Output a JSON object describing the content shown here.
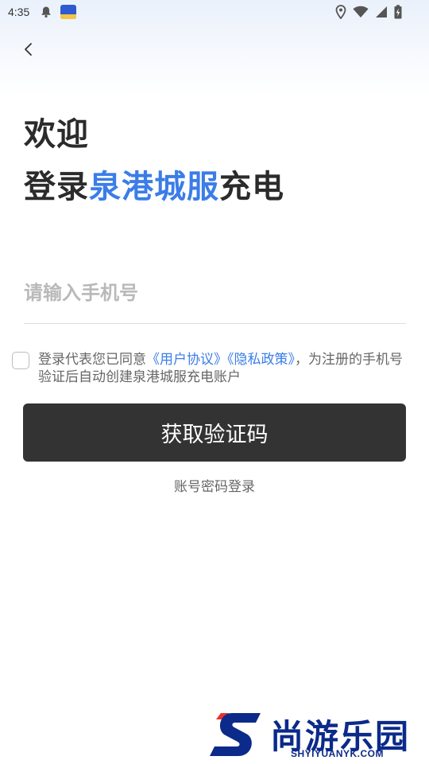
{
  "status_bar": {
    "time": "4:35",
    "icons": [
      "bell-icon",
      "app-notification-icon",
      "location-icon",
      "wifi-icon",
      "signal-icon",
      "battery-charging-icon"
    ]
  },
  "header": {
    "back_icon": "chevron-left-icon"
  },
  "title": {
    "line1": "欢迎",
    "line2_prefix": "登录",
    "line2_brand": "泉港城服",
    "line2_suffix": "充电"
  },
  "phone": {
    "placeholder": "请输入手机号",
    "value": ""
  },
  "agreement": {
    "checked": false,
    "text_before": "登录代表您已同意",
    "user_agreement": "《用户协议》",
    "privacy_policy": "《隐私政策》",
    "text_after": "，为注册的手机号验证后自动创建泉港城服充电账户"
  },
  "buttons": {
    "get_code": "获取验证码",
    "account_login": "账号密码登录"
  },
  "watermark": {
    "text": "尚游乐园",
    "url": "SHYIYUANYK.COM"
  },
  "colors": {
    "brand_blue": "#3b7de8",
    "button_dark": "#333333",
    "watermark_navy": "#0b2a8a",
    "watermark_red": "#e8322e"
  }
}
